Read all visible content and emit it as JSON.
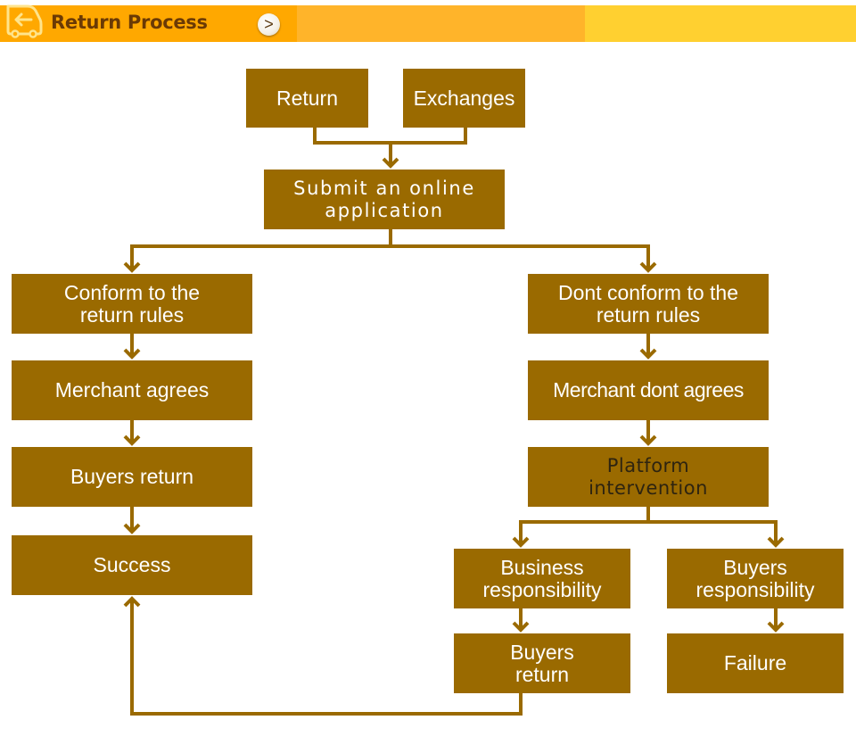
{
  "header": {
    "title": "Return Process",
    "next_button": ">",
    "colors": {
      "segment1": "#FFA800",
      "segment2": "#FFB42A",
      "segment3": "#FFD030",
      "title": "#6B3A05"
    }
  },
  "flowchart": {
    "box_color": "#9A6A00",
    "line_color": "#9A6A00",
    "nodes": {
      "return": "Return",
      "exchanges": "Exchanges",
      "submit": "Submit an online application",
      "conform": "Conform to the return rules",
      "merchant_agrees": "Merchant agrees",
      "buyers_return_left": "Buyers return",
      "success": "Success",
      "dont_conform": "Dont conform to the return rules",
      "merchant_dont_agrees": "Merchant dont agrees",
      "platform": "Platform intervention",
      "business_resp": "Business responsibility",
      "buyers_resp": "Buyers responsibility",
      "buyers_return_right": "Buyers return",
      "failure": "Failure"
    },
    "edges": [
      [
        "return",
        "submit"
      ],
      [
        "exchanges",
        "submit"
      ],
      [
        "submit",
        "conform"
      ],
      [
        "submit",
        "dont_conform"
      ],
      [
        "conform",
        "merchant_agrees"
      ],
      [
        "merchant_agrees",
        "buyers_return_left"
      ],
      [
        "buyers_return_left",
        "success"
      ],
      [
        "dont_conform",
        "merchant_dont_agrees"
      ],
      [
        "merchant_dont_agrees",
        "platform"
      ],
      [
        "platform",
        "business_resp"
      ],
      [
        "platform",
        "buyers_resp"
      ],
      [
        "business_resp",
        "buyers_return_right"
      ],
      [
        "buyers_resp",
        "failure"
      ],
      [
        "buyers_return_right",
        "success"
      ]
    ]
  }
}
